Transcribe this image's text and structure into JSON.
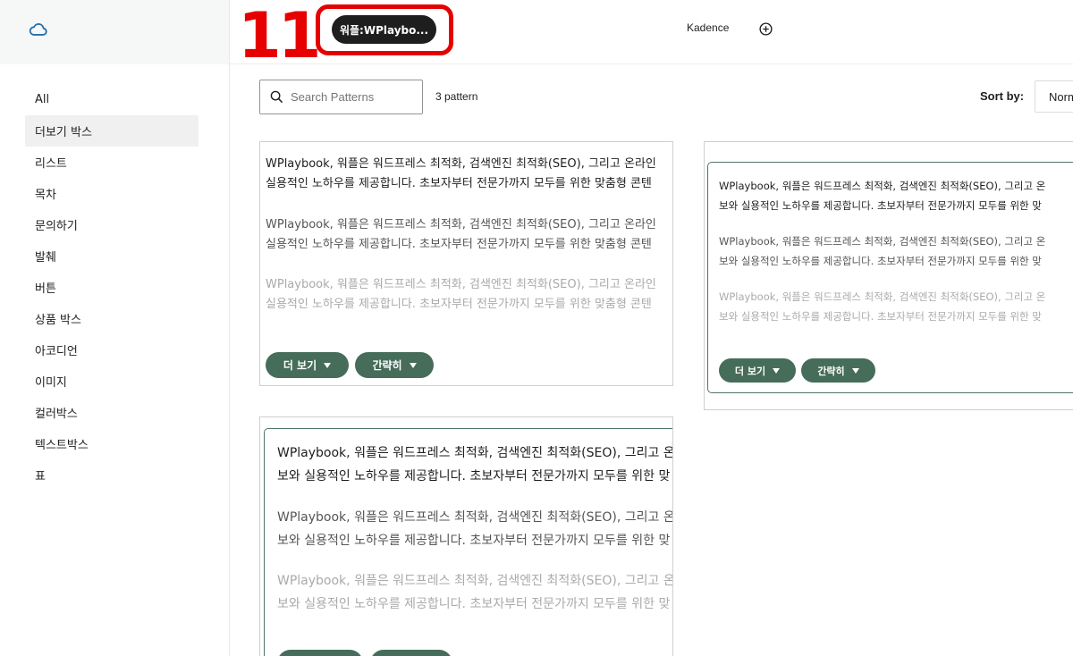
{
  "sidebar": {
    "items": [
      {
        "label": "All",
        "active": false
      },
      {
        "label": "더보기 박스",
        "active": true
      },
      {
        "label": "리스트",
        "active": false
      },
      {
        "label": "목차",
        "active": false
      },
      {
        "label": "문의하기",
        "active": false
      },
      {
        "label": "발췌",
        "active": false
      },
      {
        "label": "버튼",
        "active": false
      },
      {
        "label": "상품 박스",
        "active": false
      },
      {
        "label": "아코디언",
        "active": false
      },
      {
        "label": "이미지",
        "active": false
      },
      {
        "label": "컬러박스",
        "active": false
      },
      {
        "label": "텍스트박스",
        "active": false
      },
      {
        "label": "표",
        "active": false
      }
    ]
  },
  "header": {
    "step_number": "11",
    "active_tab": "워플:WPlaybo...",
    "tab_kadence": "Kadence",
    "highlight_color": "#e60000"
  },
  "toolbar": {
    "search_placeholder": "Search Patterns",
    "pattern_count": "3 pattern",
    "sort_label": "Sort by:",
    "sort_value": "Normal"
  },
  "cards": [
    {
      "p1": [
        "WPlaybook, 워플은 워드프레스 최적화, 검색엔진 최적화(SEO), 그리고 온라인",
        "실용적인 노하우를 제공합니다. 초보자부터 전문가까지 모두를 위한 맞춤형 콘텐"
      ],
      "p2": [
        "WPlaybook, 워플은 워드프레스 최적화, 검색엔진 최적화(SEO), 그리고 온라인",
        "실용적인 노하우를 제공합니다. 초보자부터 전문가까지 모두를 위한 맞춤형 콘텐"
      ],
      "p3": [
        "WPlaybook, 워플은 워드프레스 최적화, 검색엔진 최적화(SEO), 그리고 온라인",
        "실용적인 노하우를 제공합니다. 초보자부터 전문가까지 모두를 위한 맞춤형 콘텐"
      ],
      "more": "더 보기",
      "less": "간략히"
    },
    {
      "p1": [
        "WPlaybook, 워플은 워드프레스 최적화, 검색엔진 최적화(SEO), 그리고 온",
        "보와 실용적인 노하우를 제공합니다. 초보자부터 전문가까지 모두를 위한 맞"
      ],
      "p2": [
        "WPlaybook, 워플은 워드프레스 최적화, 검색엔진 최적화(SEO), 그리고 온",
        "보와 실용적인 노하우를 제공합니다. 초보자부터 전문가까지 모두를 위한 맞"
      ],
      "p3": [
        "WPlaybook, 워플은 워드프레스 최적화, 검색엔진 최적화(SEO), 그리고 온",
        "보와 실용적인 노하우를 제공합니다. 초보자부터 전문가까지 모두를 위한 맞"
      ],
      "more": "더 보기",
      "less": "간략히"
    },
    {
      "p1": [
        "WPlaybook, 워플은 워드프레스 최적화, 검색엔진 최적화(SEO), 그리고 온",
        "보와 실용적인 노하우를 제공합니다. 초보자부터 전문가까지 모두를 위한 맞"
      ],
      "p2": [
        "WPlaybook, 워플은 워드프레스 최적화, 검색엔진 최적화(SEO), 그리고 온",
        "보와 실용적인 노하우를 제공합니다. 초보자부터 전문가까지 모두를 위한 맞"
      ],
      "p3": [
        "WPlaybook, 워플은 워드프레스 최적화, 검색엔진 최적화(SEO), 그리고 온",
        "보와 실용적인 노하우를 제공합니다. 초보자부터 전문가까지 모두를 위한 맞"
      ]
    }
  ]
}
